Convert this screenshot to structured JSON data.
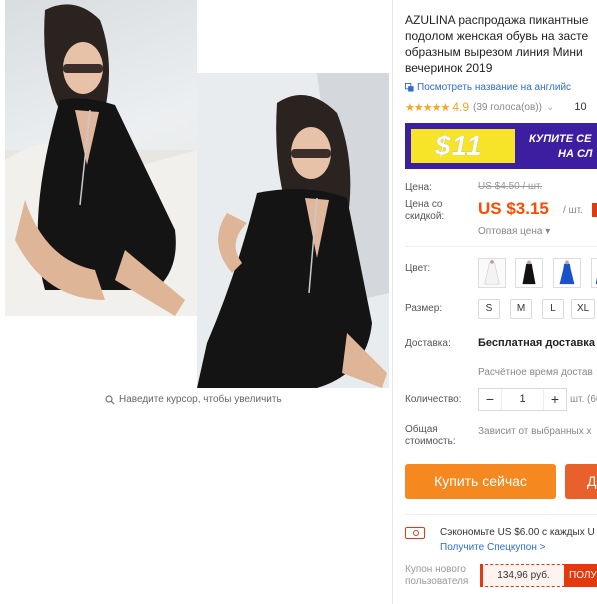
{
  "gallery": {
    "zoom_hint": "Наведите курсор, чтобы увеличить"
  },
  "product": {
    "title_lines": [
      "AZULINA распродажа пикантные",
      "подолом женская обувь на засте",
      "образным вырезом линия Мини",
      "вечеринок 2019"
    ],
    "translate_link": "Посмотреть название на английс",
    "rating_value": "4.9",
    "rating_count": "(39 голоса(ов))",
    "orders": "10",
    "stars": "★★★★★"
  },
  "banner": {
    "amount": "$11",
    "line1": "КУПИТЕ СЕ",
    "line2": "НА СЛ"
  },
  "price": {
    "label_price": "Цена:",
    "old_price": "US $4.50 / шт.",
    "label_discount_1": "Цена со",
    "label_discount_2": "скидкой:",
    "new_price": "US $3.15",
    "per_unit": "/ шт.",
    "wholesale": "Оптовая цена ▾"
  },
  "color": {
    "label": "Цвет:",
    "swatches": [
      "white-dress",
      "black-dress",
      "blue-dress",
      "blue-dress-alt"
    ]
  },
  "size": {
    "label": "Размер:",
    "options": [
      "S",
      "M",
      "L",
      "XL"
    ]
  },
  "shipping": {
    "label": "Доставка:",
    "method": "Бесплатная доставка в",
    "time": "Расчётное время достав"
  },
  "quantity": {
    "label": "Количество:",
    "value": "1",
    "minus": "−",
    "plus": "+",
    "unit": "шт. (60"
  },
  "total": {
    "label_1": "Общая",
    "label_2": "стоимость:",
    "value": "Зависит от выбранных х"
  },
  "actions": {
    "buy_now": "Купить сейчас",
    "add_to_cart": "Д"
  },
  "coupon": {
    "save_text": "Сэкономьте US $6.00 с каждых U",
    "get_link": "Получите Спецкупон >",
    "newuser_label_1": "Купон нового",
    "newuser_label_2": "пользователя",
    "newuser_amount": "134,96 руб.",
    "newuser_get": "ПОЛУ"
  },
  "colors": {
    "accent_orange": "#f5891f",
    "price_red": "#ff4a00",
    "link_blue": "#2e6ccf",
    "banner_purple": "#3c1fa0",
    "banner_yellow": "#f7e428"
  }
}
